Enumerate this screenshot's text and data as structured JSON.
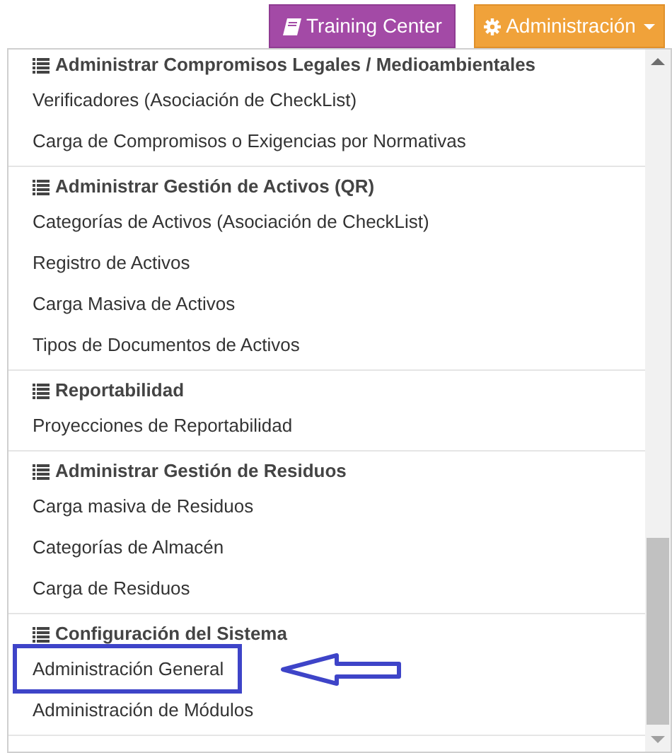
{
  "toolbar": {
    "buttons": [
      {
        "label": "Training Center",
        "kind": "book"
      },
      {
        "label": "Administración",
        "kind": "gear"
      }
    ]
  },
  "menu": {
    "sections": [
      {
        "title": "Administrar Compromisos Legales / Medioambientales",
        "items": [
          {
            "label": "Verificadores (Asociación de CheckList)",
            "annotated": false
          },
          {
            "label": "Carga de Compromisos o Exigencias por Normativas",
            "annotated": false
          }
        ]
      },
      {
        "title": "Administrar Gestión de Activos (QR)",
        "items": [
          {
            "label": "Categorías de Activos (Asociación de CheckList)",
            "annotated": false
          },
          {
            "label": "Registro de Activos",
            "annotated": false
          },
          {
            "label": "Carga Masiva de Activos",
            "annotated": false
          },
          {
            "label": "Tipos de Documentos de Activos",
            "annotated": false
          }
        ]
      },
      {
        "title": "Reportabilidad",
        "items": [
          {
            "label": "Proyecciones de Reportabilidad",
            "annotated": false
          }
        ]
      },
      {
        "title": "Administrar Gestión de Residuos",
        "items": [
          {
            "label": "Carga masiva de Residuos",
            "annotated": false
          },
          {
            "label": "Categorías de Almacén",
            "annotated": false
          },
          {
            "label": "Carga de Residuos",
            "annotated": false
          }
        ]
      },
      {
        "title": "Configuración del Sistema",
        "items": [
          {
            "label": "Administración General",
            "annotated": true
          },
          {
            "label": "Administración de Módulos",
            "annotated": false
          }
        ]
      }
    ]
  }
}
